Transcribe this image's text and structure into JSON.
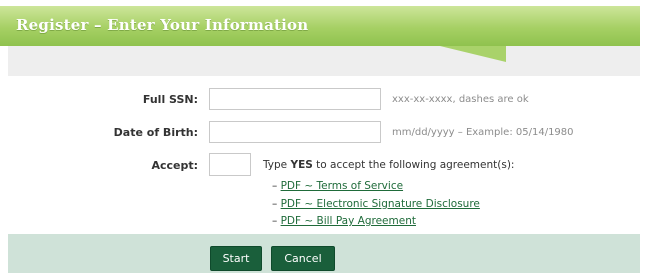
{
  "header": {
    "title": "Register – Enter Your Information"
  },
  "form": {
    "ssn": {
      "label": "Full SSN:",
      "value": "",
      "hint": "xxx-xx-xxxx, dashes are ok"
    },
    "dob": {
      "label": "Date of Birth:",
      "value": "",
      "hint": "mm/dd/yyyy – Example: 05/14/1980"
    },
    "accept": {
      "label": "Accept:",
      "value": "",
      "text_prefix": "Type ",
      "text_bold": "YES",
      "text_suffix": " to accept the following agreement(s):",
      "links": [
        {
          "dash": "– ",
          "label": "PDF ~ Terms of Service"
        },
        {
          "dash": "– ",
          "label": "PDF ~ Electronic Signature Disclosure"
        },
        {
          "dash": "– ",
          "label": "PDF ~ Bill Pay Agreement"
        }
      ]
    }
  },
  "buttons": {
    "start": "Start",
    "cancel": "Cancel"
  },
  "colors": {
    "header_green": "#a6d064",
    "button_green": "#1a5f3b",
    "footer_bg": "#cfe2d8",
    "link": "#1f6b3a"
  }
}
